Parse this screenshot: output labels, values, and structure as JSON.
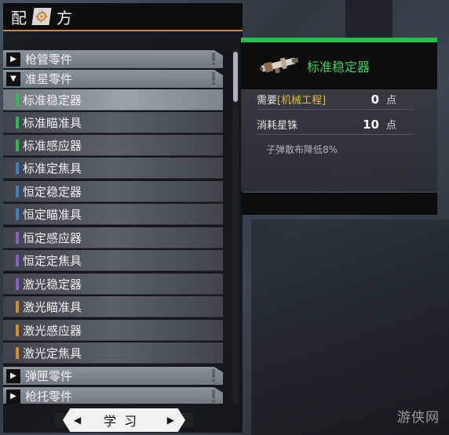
{
  "panel": {
    "title_left": "配",
    "title_right": "方",
    "header_icon": "gear-icon"
  },
  "categories_top": [
    {
      "label": "枪管零件",
      "expanded": false
    },
    {
      "label": "准星零件",
      "expanded": true
    }
  ],
  "items": [
    {
      "label": "标准稳定器",
      "tier_color": "#22c14a",
      "selected": true
    },
    {
      "label": "标准瞄准具",
      "tier_color": "#22c14a",
      "selected": false
    },
    {
      "label": "标准感应器",
      "tier_color": "#22c14a",
      "selected": false
    },
    {
      "label": "标准定焦具",
      "tier_color": "#3a7fd0",
      "selected": false
    },
    {
      "label": "恒定稳定器",
      "tier_color": "#3a7fd0",
      "selected": false
    },
    {
      "label": "恒定瞄准具",
      "tier_color": "#3a7fd0",
      "selected": false
    },
    {
      "label": "恒定感应器",
      "tier_color": "#8a5cd6",
      "selected": false
    },
    {
      "label": "恒定定焦具",
      "tier_color": "#8a5cd6",
      "selected": false
    },
    {
      "label": "激光稳定器",
      "tier_color": "#8a5cd6",
      "selected": false
    },
    {
      "label": "激光瞄准具",
      "tier_color": "#e08a1e",
      "selected": false
    },
    {
      "label": "激光感应器",
      "tier_color": "#e08a1e",
      "selected": false
    },
    {
      "label": "激光定焦具",
      "tier_color": "#e08a1e",
      "selected": false
    }
  ],
  "categories_bottom": [
    {
      "label": "弹匣零件",
      "expanded": false
    },
    {
      "label": "枪托零件",
      "expanded": false
    }
  ],
  "learn_button": {
    "label": "学习",
    "prev_icon": "caret-left-icon",
    "next_icon": "caret-right-icon"
  },
  "detail": {
    "name": "标准稳定器",
    "accent_color": "#22c14a",
    "requirement": {
      "prefix": "需要",
      "skill": "[机械工程]",
      "value": "0",
      "unit": "点"
    },
    "cost": {
      "label": "消耗星铢",
      "value": "10",
      "unit": "点"
    },
    "description": "子弹散布降低8%"
  },
  "watermark": "游侠网"
}
